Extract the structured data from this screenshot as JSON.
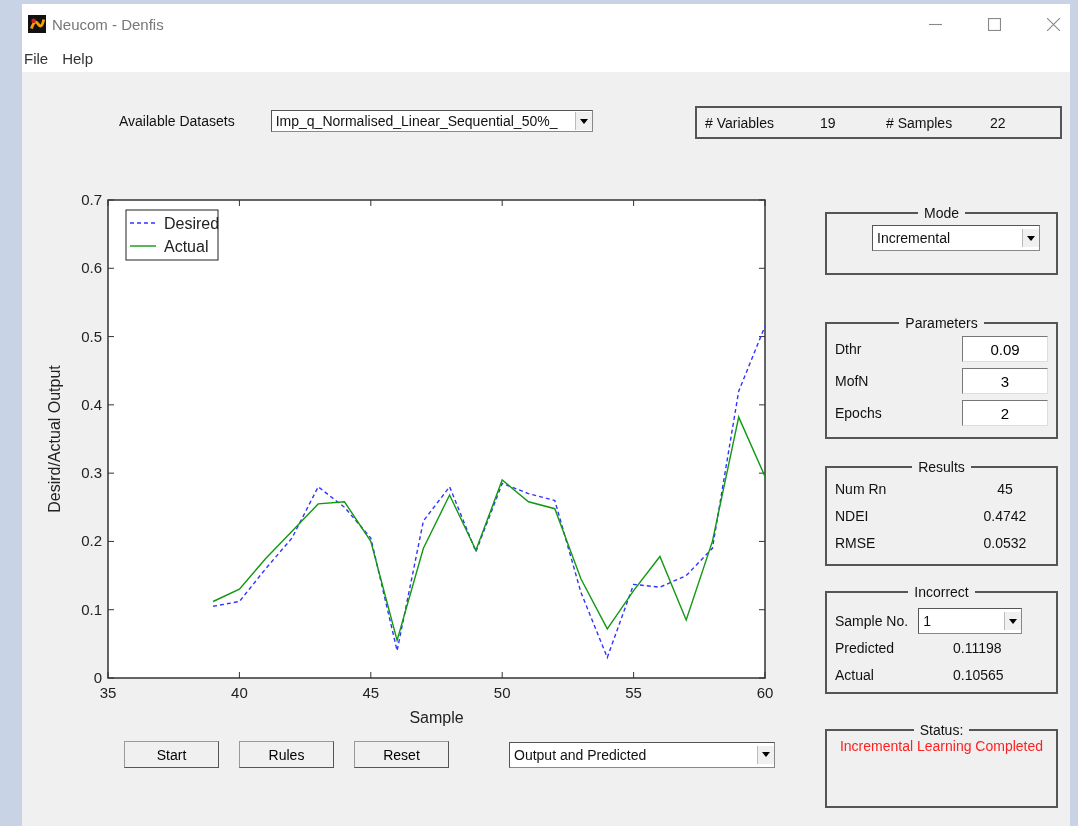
{
  "window": {
    "title": "Neucom - Denfis"
  },
  "menu": [
    "File",
    "Help"
  ],
  "datasets": {
    "label": "Available Datasets",
    "value": "Imp_q_Normalised_Linear_Sequential_50%_"
  },
  "info": [
    {
      "label": "# Variables",
      "value": "19"
    },
    {
      "label": "# Samples",
      "value": "22"
    }
  ],
  "chart_data": {
    "type": "line",
    "xlabel": "Sample",
    "ylabel": "Desird/Actual Output",
    "x": [
      39,
      40,
      41,
      42,
      43,
      44,
      45,
      46,
      47,
      48,
      49,
      50,
      51,
      52,
      53,
      54,
      55,
      56,
      57,
      58,
      59,
      60
    ],
    "series": [
      {
        "name": "Desired",
        "color": "#3333ff",
        "line_style": "dashed",
        "values": [
          0.105,
          0.112,
          0.16,
          0.205,
          0.28,
          0.25,
          0.205,
          0.04,
          0.23,
          0.28,
          0.185,
          0.285,
          0.27,
          0.26,
          0.125,
          0.03,
          0.137,
          0.133,
          0.15,
          0.19,
          0.42,
          0.515
        ]
      },
      {
        "name": "Actual",
        "color": "#119911",
        "line_style": "solid",
        "values": [
          0.112,
          0.13,
          0.175,
          0.215,
          0.255,
          0.258,
          0.2,
          0.055,
          0.19,
          0.268,
          0.187,
          0.29,
          0.258,
          0.248,
          0.145,
          0.072,
          0.128,
          0.178,
          0.085,
          0.2,
          0.382,
          0.295
        ]
      }
    ],
    "legend": true,
    "xlim": [
      35,
      60
    ],
    "ylim": [
      0,
      0.7
    ],
    "xticks": [
      35,
      40,
      45,
      50,
      55,
      60
    ],
    "yticks": [
      0,
      0.1,
      0.2,
      0.3,
      0.4,
      0.5,
      0.6,
      0.7
    ]
  },
  "buttons": [
    "Start",
    "Rules",
    "Reset"
  ],
  "plot_select": {
    "value": "Output and Predicted"
  },
  "mode": {
    "title": "Mode",
    "value": "Incremental"
  },
  "parameters": {
    "title": "Parameters",
    "items": [
      {
        "label": "Dthr",
        "value": "0.09"
      },
      {
        "label": "MofN",
        "value": "3"
      },
      {
        "label": "Epochs",
        "value": "2"
      }
    ]
  },
  "results": {
    "title": "Results",
    "items": [
      {
        "label": "Num Rn",
        "value": "45"
      },
      {
        "label": "NDEI",
        "value": "0.4742"
      },
      {
        "label": "RMSE",
        "value": "0.0532"
      }
    ]
  },
  "incorrect": {
    "title": "Incorrect",
    "sample_label": "Sample No.",
    "sample_value": "1",
    "items": [
      {
        "label": "Predicted",
        "value": "0.11198"
      },
      {
        "label": "Actual",
        "value": "0.10565"
      }
    ]
  },
  "status": {
    "title": "Status:",
    "message": "Incremental Learning Completed"
  }
}
